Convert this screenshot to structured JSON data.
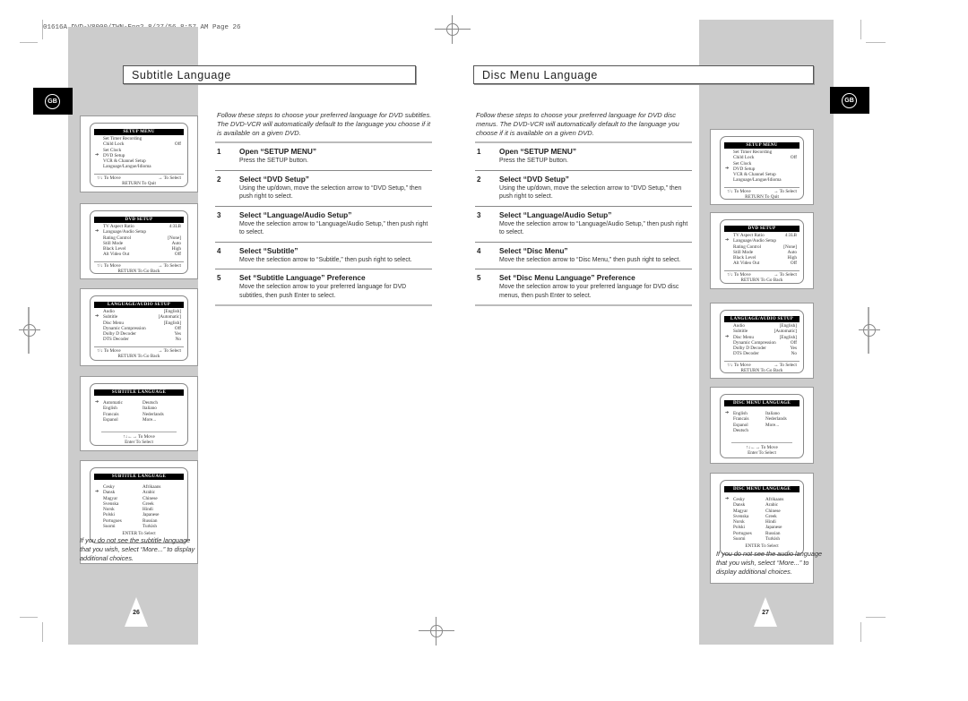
{
  "print_header": "01616A DVD-V8000/TWN-Eng2  8/27/56 8:57 AM  Page 26",
  "badge_label": "GB",
  "left_page": {
    "title": "Subtitle Language",
    "intro": "Follow these steps to choose your preferred language for DVD subtitles. The DVD-VCR will automatically default to the language you choose if it is available on a given DVD.",
    "steps": [
      {
        "num": "1",
        "head": "Open “SETUP MENU”",
        "body": "Press the SETUP button."
      },
      {
        "num": "2",
        "head": "Select “DVD Setup”",
        "body": "Using the up/down, move the selection arrow to “DVD Setup,” then push right to select."
      },
      {
        "num": "3",
        "head": "Select “Language/Audio Setup”",
        "body": "Move the selection arrow to “Language/Audio Setup,” then push right to select."
      },
      {
        "num": "4",
        "head": "Select “Subtitle”",
        "body": "Move the selection arrow to “Subtitle,” then push right to select."
      },
      {
        "num": "5",
        "head": "Set “Subtitle Language” Preference",
        "body": "Move the selection arrow to your preferred language for DVD subtitles, then push Enter to select."
      }
    ],
    "screens": {
      "setup": {
        "title": "SETUP MENU",
        "rows": [
          [
            "Set Timer Recording",
            ""
          ],
          [
            "Child Lock",
            "Off"
          ],
          [
            "Set Clock",
            ""
          ],
          [
            "DVD Setup",
            ""
          ],
          [
            "VCR & Channel Setup",
            ""
          ],
          [
            "Language/Langue/Idioma",
            ""
          ]
        ],
        "nav_left": "↑/↓ To Move",
        "nav_right": "→ To Select",
        "ret": "RETURN To Quit"
      },
      "dvd": {
        "title": "DVD SETUP",
        "rows": [
          [
            "TV Aspect Ratio",
            "4:3LB"
          ],
          [
            "Language/Audio Setup",
            ""
          ],
          [
            "Rating Control",
            "[None]"
          ],
          [
            "Still Mode",
            "Auto"
          ],
          [
            "Black Level",
            "High"
          ],
          [
            "Alt Video Out",
            "Off"
          ]
        ],
        "nav_left": "↑/↓ To Move",
        "nav_right": "→ To Select",
        "ret": "RETURN To Go Back"
      },
      "lang": {
        "title": "LANGUAGE/AUDIO SETUP",
        "rows": [
          [
            "Audio",
            "[English]"
          ],
          [
            "Subtitle",
            "[Automatic]"
          ],
          [
            "Disc Menu",
            "[English]"
          ],
          [
            "Dynamic Compression",
            "Off"
          ],
          [
            "Dolby D Decoder",
            "Yes"
          ],
          [
            "DTS Decoder",
            "No"
          ]
        ],
        "nav_left": "↑/↓ To Move",
        "nav_right": "→ To Select",
        "ret": "RETURN To Go Back"
      },
      "sub1": {
        "title": "SUBTITLE LANGUAGE",
        "items": [
          "Automatic",
          "Deutsch",
          "English",
          "Italiano",
          "Francais",
          "Nederlands",
          "Espanol",
          "More..."
        ],
        "nav": "↑↓←→ To Move",
        "enter": "Enter To Select"
      },
      "sub2": {
        "title": "SUBTITLE LANGUAGE",
        "items": [
          "Cesky",
          "Afrikaans",
          "Dansk",
          "Arabic",
          "Magyar",
          "Chinese",
          "Svenska",
          "Greek",
          "Norsk",
          "Hindi",
          "Polski",
          "Japanese",
          "Portugues",
          "Russian",
          "Suomi",
          "Turkish"
        ],
        "enter": "ENTER To Select"
      }
    },
    "caption": "If you do not see the subtitle language that you wish, select “More...” to display additional choices.",
    "page_number": "26"
  },
  "right_page": {
    "title": "Disc Menu Language",
    "intro": "Follow these steps to choose your preferred language for DVD disc menus. The DVD-VCR will automatically default to the language you choose if it is available on a given DVD.",
    "steps": [
      {
        "num": "1",
        "head": "Open “SETUP MENU”",
        "body": "Press the SETUP button."
      },
      {
        "num": "2",
        "head": "Select “DVD Setup”",
        "body": "Using the up/down, move the selection arrow to “DVD Setup,” then push right to select."
      },
      {
        "num": "3",
        "head": "Select “Language/Audio Setup”",
        "body": "Move the selection arrow to “Language/Audio Setup,” then push right to select."
      },
      {
        "num": "4",
        "head": "Select “Disc Menu”",
        "body": "Move the selection arrow to “Disc Menu,” then push right to select."
      },
      {
        "num": "5",
        "head": "Set “Disc Menu Language” Preference",
        "body": "Move the selection arrow to your preferred language for DVD disc menus, then push Enter to select."
      }
    ],
    "screens": {
      "setup": {
        "title": "SETUP MENU",
        "rows": [
          [
            "Set Timer Recording",
            ""
          ],
          [
            "Child Lock",
            "Off"
          ],
          [
            "Set Clock",
            ""
          ],
          [
            "DVD Setup",
            ""
          ],
          [
            "VCR & Channel Setup",
            ""
          ],
          [
            "Language/Langue/Idioma",
            ""
          ]
        ],
        "nav_left": "↑/↓ To Move",
        "nav_right": "→ To Select",
        "ret": "RETURN To Quit"
      },
      "dvd": {
        "title": "DVD SETUP",
        "rows": [
          [
            "TV Aspect Ratio",
            "4:3LB"
          ],
          [
            "Language/Audio Setup",
            ""
          ],
          [
            "Rating Control",
            "[None]"
          ],
          [
            "Still Mode",
            "Auto"
          ],
          [
            "Black Level",
            "High"
          ],
          [
            "Alt Video Out",
            "Off"
          ]
        ],
        "nav_left": "↑/↓ To Move",
        "nav_right": "→ To Select",
        "ret": "RETURN To Go Back"
      },
      "lang": {
        "title": "LANGUAGE/AUDIO SETUP",
        "rows": [
          [
            "Audio",
            "[English]"
          ],
          [
            "Subtitle",
            "[Automatic]"
          ],
          [
            "Disc Menu",
            "[English]"
          ],
          [
            "Dynamic Compression",
            "Off"
          ],
          [
            "Dolby D Decoder",
            "Yes"
          ],
          [
            "DTS Decoder",
            "No"
          ]
        ],
        "nav_left": "↑/↓ To Move",
        "nav_right": "→ To Select",
        "ret": "RETURN To Go Back"
      },
      "disc1": {
        "title": "DISC MENU LANGUAGE",
        "items": [
          "English",
          "Italiano",
          "Francais",
          "Nederlands",
          "Espanol",
          "More...",
          "Deutsch",
          ""
        ],
        "nav": "↑↓←→ To Move",
        "enter": "Enter To Select"
      },
      "disc2": {
        "title": "DISC MENU LANGUAGE",
        "items": [
          "Cesky",
          "Afrikaans",
          "Dansk",
          "Arabic",
          "Magyar",
          "Chinese",
          "Svenska",
          "Greek",
          "Norsk",
          "Hindi",
          "Polski",
          "Japanese",
          "Portugues",
          "Russian",
          "Suomi",
          "Turkish"
        ],
        "enter": "ENTER To Select"
      }
    },
    "caption": "If you do not see the audio language that you wish, select “More...” to display additional choices.",
    "page_number": "27"
  }
}
